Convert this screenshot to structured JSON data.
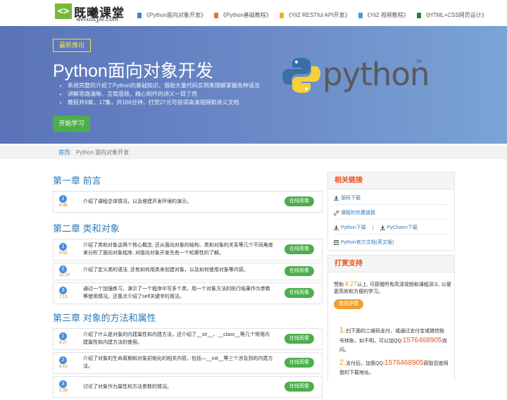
{
  "header": {
    "logo_icon": "<>",
    "logo_cn": "既曦课堂",
    "logo_en": "weixistyle.com",
    "nav": [
      {
        "label": "《Python面向对象开发》",
        "color": "#4a7fc1"
      },
      {
        "label": "《Python基础教程》",
        "color": "#e8703a"
      },
      {
        "label": "《Yii2 RESTful API开发》",
        "color": "#f0b020"
      },
      {
        "label": "《Yii2 视频教程》",
        "color": "#4a9ad9"
      },
      {
        "label": "《HTML+CSS网页设计》",
        "color": "#2e7d32"
      }
    ]
  },
  "banner": {
    "badge": "最新推出",
    "title": "Python面向对象开发",
    "bullets": [
      "系统完整的介绍了Python的基础知识，借助大量代码实例来理解掌握各种语法",
      "讲解思路清晰、言简意赅，精心制作的讲义一目了然",
      "教程共9章，17集，共166分钟，打赏27元可获得高清视频和讲义文档"
    ],
    "start_button": "开始学习",
    "python_word": "python",
    "tm": "TM"
  },
  "breadcrumb": {
    "home": "首页",
    "separator": "/",
    "current": "Python 面向对象开发"
  },
  "chapters": [
    {
      "title": "第一章 前言",
      "lessons": [
        {
          "num": "1",
          "dur": "6:48",
          "desc": "介绍了课程总体情况，以及搭建开发环境的演示。"
        }
      ]
    },
    {
      "title": "第二章 类和对象",
      "lessons": [
        {
          "num": "1",
          "dur": "9:59",
          "desc": "介绍了类和对象这两个核心概念, 还从面向对象的结构、类和对象的关系等几个不同角度来分析了面向对象程序, 对面向对象开发先有一个轮廓性的了解。"
        },
        {
          "num": "2",
          "dur": "12:10",
          "desc": "介绍了定义类的语法, 还有如何用类来创建对象，以及如何使用对象等内容。"
        },
        {
          "num": "3",
          "dur": "7:13",
          "desc": "通过一个加强练习，演示了一个程序中写多个类，用一个对象方法的执行结果作为参数等使用情况。还重点介绍了self关键字的用法。"
        }
      ]
    },
    {
      "title": "第三章 对象的方法和属性",
      "lessons": [
        {
          "num": "1",
          "dur": "9:27",
          "desc": "介绍了什么是对象的内建属性和内建方法，还介绍了__str__、__class__等几个常用内建属性和内建方法的使用。"
        },
        {
          "num": "2",
          "dur": "8:15",
          "desc": "介绍了对象的生命周期和对象初始化的相关内容，包括—__init__等三个涉及到的内建方法。"
        },
        {
          "num": "3",
          "dur": "5:39",
          "desc": "讨论了对象作为属性和方法参数的情况。"
        }
      ]
    }
  ],
  "watch_label": "在线观看",
  "sidebar": {
    "links_title": "相关链接",
    "links": {
      "source": "源码下载",
      "discount": "课程的优惠链接",
      "python_dl": "Python下载",
      "divider": "|",
      "pycharm_dl": "PyCharm下载",
      "docs": "Python官方文档(英文版)"
    },
    "donate_title": "打赏支持",
    "donate_pre": "赞助",
    "donate_amount": "￥27",
    "donate_post": "以上, 可获赠所有高清视频和课程讲义, 以便更高效和方便的学习。",
    "detail_button": "查阅详情",
    "steps": [
      {
        "n": "1.",
        "pre": "扫下面的二维码支付，或通过支付宝或微信账号转账，如不明，可以加QQ:",
        "qq": "1576468905",
        "post": "询问。"
      },
      {
        "n": "2.",
        "pre": "支付后，加我QQ:",
        "qq": "1576468905",
        "post": "获取百度网盘的下载地址。"
      }
    ]
  }
}
